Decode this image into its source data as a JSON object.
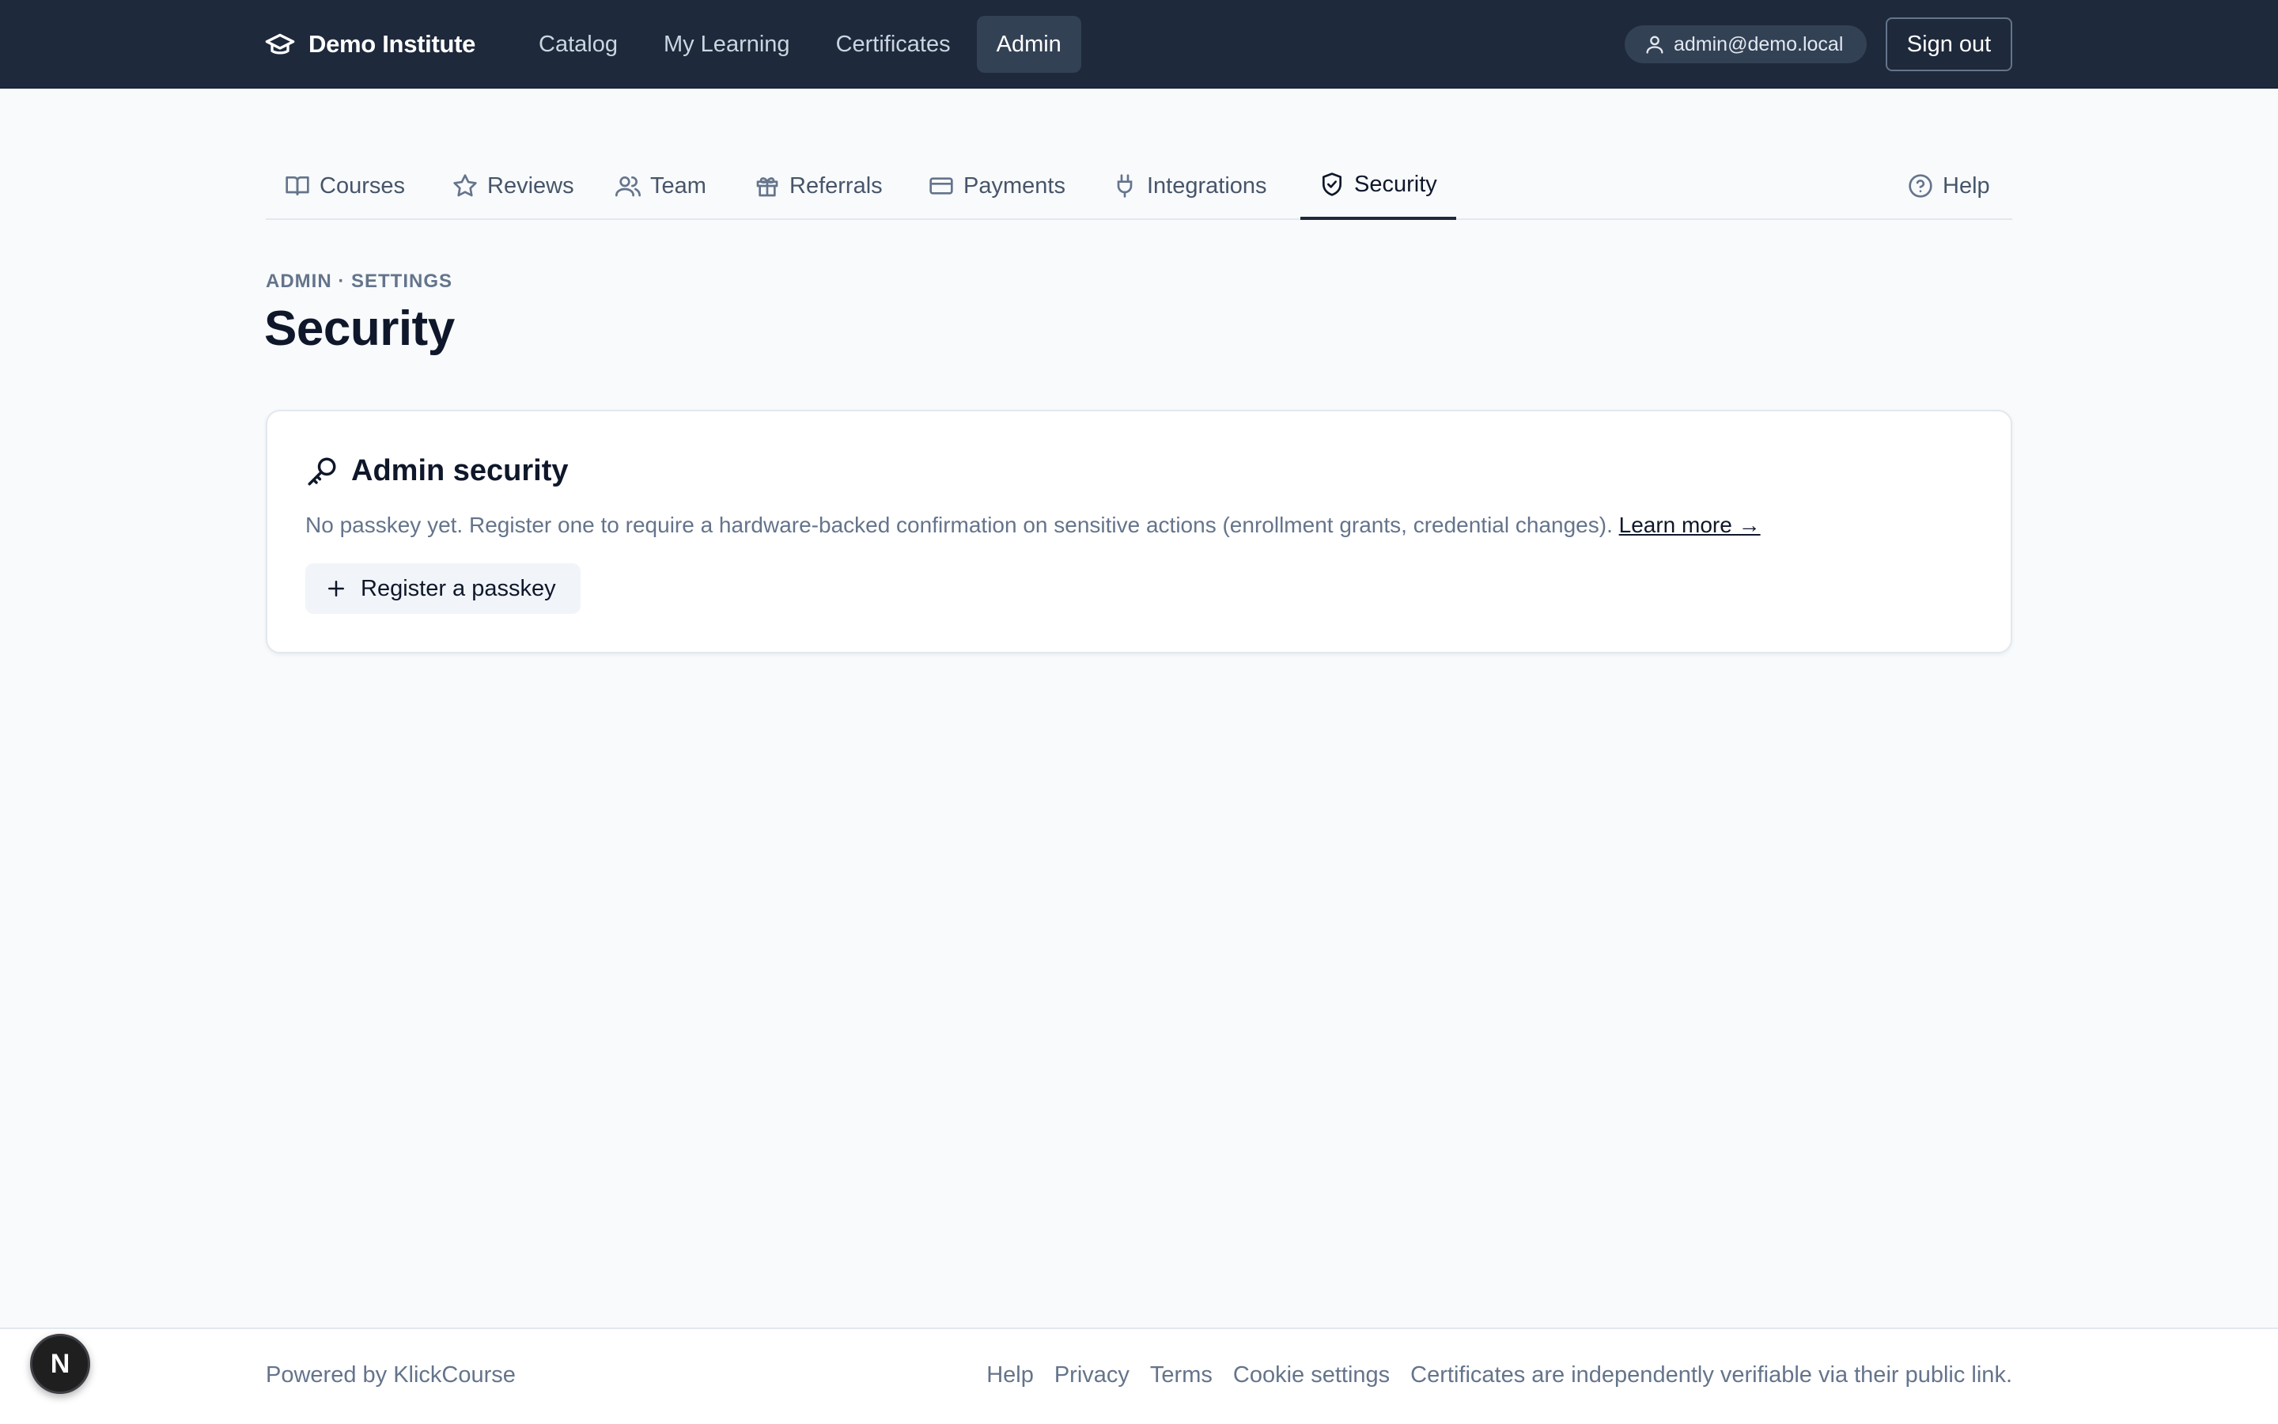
{
  "header": {
    "brand": "Demo Institute",
    "nav": [
      "Catalog",
      "My Learning",
      "Certificates",
      "Admin"
    ],
    "active_nav": "Admin",
    "user_email": "admin@demo.local",
    "sign_out": "Sign out"
  },
  "subnav": {
    "tabs": [
      {
        "label": "Courses",
        "icon": "book-icon"
      },
      {
        "label": "Reviews",
        "icon": "star-icon"
      },
      {
        "label": "Team",
        "icon": "users-icon"
      },
      {
        "label": "Referrals",
        "icon": "gift-icon"
      },
      {
        "label": "Payments",
        "icon": "credit-card-icon"
      },
      {
        "label": "Integrations",
        "icon": "plug-icon"
      },
      {
        "label": "Security",
        "icon": "shield-check-icon"
      }
    ],
    "active_tab": "Security",
    "help": "Help"
  },
  "page": {
    "eyebrow": "ADMIN · SETTINGS",
    "title": "Security"
  },
  "card": {
    "title": "Admin security",
    "text": "No passkey yet. Register one to require a hardware-backed confirmation on sensitive actions (enrollment grants, credential changes).",
    "learn_more": "Learn more →",
    "button": "Register a passkey"
  },
  "footer": {
    "powered": "Powered by KlickCourse",
    "links": [
      "Help",
      "Privacy",
      "Terms",
      "Cookie settings"
    ],
    "note": "Certificates are independently verifiable via their public link."
  },
  "dev_badge": "N",
  "colors": {
    "topbar": "#1e293b",
    "background": "#f8fafc",
    "accent": "#1e293b",
    "muted": "#64748b"
  }
}
